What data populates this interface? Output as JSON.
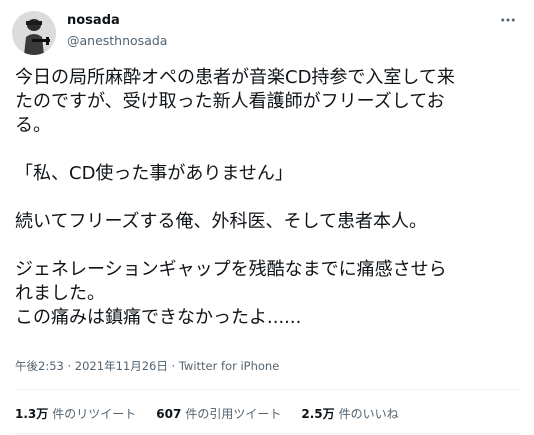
{
  "user": {
    "display_name": "nosada",
    "handle": "@anesthnosada"
  },
  "tweet": {
    "lines": [
      "今日の局所麻酔オペの患者が音楽CD持参で入室して来",
      "たのですが、受け取った新人看護師がフリーズしてお",
      "る。",
      "",
      "「私、CD使った事がありません」",
      "",
      "続いてフリーズする俺、外科医、そして患者本人。",
      "",
      "ジェネレーションギャップを残酷なまでに痛感させら",
      "れました。",
      "この痛みは鎮痛できなかったよ......"
    ]
  },
  "meta": {
    "time": "午後2:53",
    "separator1": "·",
    "date": "2021年11月26日",
    "separator2": "·",
    "source": "Twitter for iPhone"
  },
  "stats": {
    "retweets": {
      "count": "1.3万",
      "label": "件のリツイート"
    },
    "quotes": {
      "count": "607",
      "label": "件の引用ツイート"
    },
    "likes": {
      "count": "2.5万",
      "label": "件のいいね"
    }
  },
  "icons": {
    "avatar": "avatar-image",
    "more": "more-options-icon"
  },
  "colors": {
    "text": "#0f1419",
    "secondary": "#536471",
    "divider": "#eff3f4"
  }
}
